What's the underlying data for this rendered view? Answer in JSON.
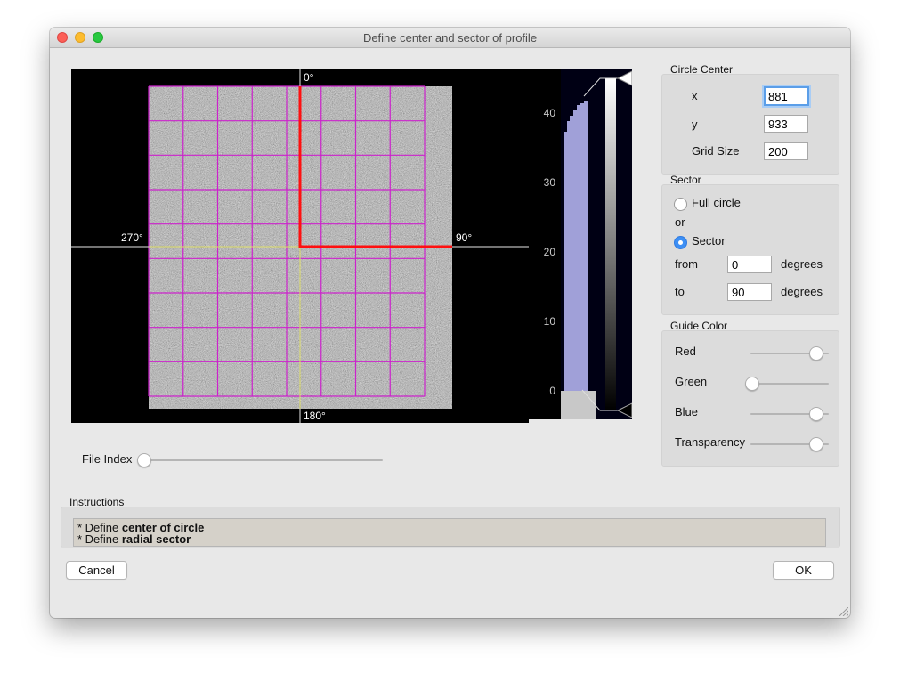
{
  "window": {
    "title": "Define center and sector of profile"
  },
  "plot": {
    "angle_labels": {
      "top": "0°",
      "right": "90°",
      "bottom": "180°",
      "left": "270°"
    },
    "colors": {
      "grid": "#cc22cc",
      "sector": "#ff1010",
      "crosshair": "#dddd66"
    }
  },
  "histogram": {
    "ticks": [
      "40",
      "30",
      "20",
      "10",
      "0"
    ],
    "ylim": [
      0,
      45
    ],
    "colors": {
      "fill": "#a0a0d8",
      "background": "#000014"
    }
  },
  "circle_center": {
    "title": "Circle Center",
    "x_label": "x",
    "x_value": "881",
    "y_label": "y",
    "y_value": "933",
    "grid_label": "Grid Size",
    "grid_value": "200"
  },
  "sector": {
    "title": "Sector",
    "full_circle_label": "Full circle",
    "or_label": "or",
    "sector_label": "Sector",
    "selected": "Sector",
    "from_label": "from",
    "from_value": "0",
    "from_unit": "degrees",
    "to_label": "to",
    "to_value": "90",
    "to_unit": "degrees"
  },
  "guide_color": {
    "title": "Guide Color",
    "red_label": "Red",
    "red_value": 1.0,
    "green_label": "Green",
    "green_value": 0.0,
    "blue_label": "Blue",
    "blue_value": 1.0,
    "transparency_label": "Transparency",
    "transparency_value": 1.0
  },
  "file_index": {
    "label": "File Index",
    "value": 0.0
  },
  "instructions": {
    "title": "Instructions",
    "line1_prefix": "* Define ",
    "line1_bold": "center of circle",
    "line2_prefix": "* Define ",
    "line2_bold": "radial sector"
  },
  "buttons": {
    "cancel": "Cancel",
    "ok": "OK"
  }
}
